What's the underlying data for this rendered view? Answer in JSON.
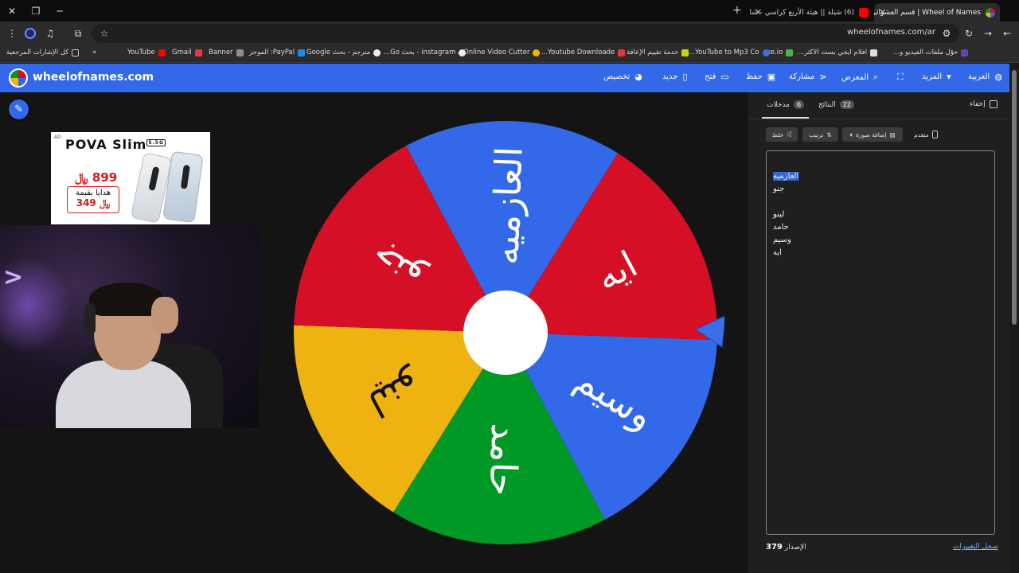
{
  "browser": {
    "tabs": [
      {
        "title": "Wheel of Names | قسم العشوائي",
        "active": true
      },
      {
        "title": "(6) شيلة || هيئة الأربع كراسي - شا",
        "active": false
      }
    ],
    "url": "wheelofnames.com/ar",
    "bookmarks": [
      "حوّل ملفات الفيديو و...",
      "افلام ايجي بست الاكثر...",
      "exe.io",
      "YouTube to Mp3 Co...",
      "خدمة تقييم الإعاقة",
      "Youtube Downloade...",
      "Online Video Cutter...",
      "instagram - بحث Go...",
      "مترجم - بحث Google",
      "PayPal: الموجز",
      "Banner",
      "Gmail",
      "YouTube",
      "كل الإشارات المرجعية"
    ]
  },
  "app": {
    "brand": "wheelofnames.com",
    "nav": {
      "language": "العربية",
      "more": "المزيد",
      "gallery": "المعرض",
      "share": "مشاركة",
      "save": "حفظ",
      "open": "فتح",
      "new": "جديد",
      "customize": "تخصيص"
    }
  },
  "ad": {
    "tag": "AD",
    "title": "POVA Slim",
    "badge": "5.5G",
    "price": "899 ﷼",
    "gift_line1": "هدايا بقيمة",
    "gift_line2": "349 ﷼"
  },
  "wheel": {
    "segments": [
      {
        "label": "وسيم",
        "color": "#3369e8"
      },
      {
        "label": "حامد",
        "color": "#009925"
      },
      {
        "label": "لينو",
        "color": "#eeb211"
      },
      {
        "label": "جنو",
        "color": "#d50f25"
      },
      {
        "label": "العازميه",
        "color": "#3369e8"
      },
      {
        "label": "ايه",
        "color": "#d50f25"
      }
    ]
  },
  "panel": {
    "tabs": {
      "entries_label": "مدخلات",
      "entries_count": "6",
      "results_label": "النتائج",
      "results_count": "22",
      "hide_label": "إخفاء"
    },
    "buttons": {
      "shuffle": "خلط",
      "sort": "ترتيب",
      "add_image": "إضافة صورة",
      "advanced": "متقدم"
    },
    "entries": [
      "العازميه",
      "جنو",
      "",
      "لينو",
      "حامد",
      "وسيم",
      "ايه"
    ],
    "changelog": "سجل التغييرات",
    "version_label": "الإصدار",
    "version": "379"
  }
}
